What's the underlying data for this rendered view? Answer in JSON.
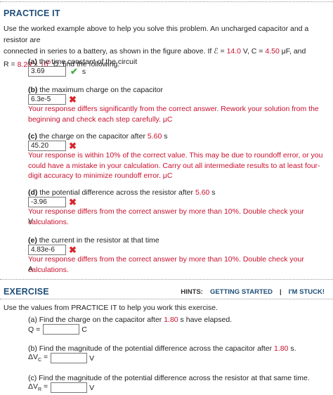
{
  "practice": {
    "title": "PRACTICE IT",
    "intro_line1": "Use the worked example above to help you solve this problem. An uncharged capacitor and a resistor are",
    "intro_line2_a": "connected in series to a battery, as shown in the figure above. If ℰ = ",
    "emf": "14.0",
    "intro_line2_b": " V, C = ",
    "cap": "4.50",
    "intro_line2_c": " μF, and",
    "intro_line3_a": "R = ",
    "res": "8.20 × 10",
    "res_exp": "5",
    "intro_line3_b": " Ω, find the following.",
    "parts": [
      {
        "label": "(a)",
        "question": " the time constant of the circuit",
        "answer": "3.69",
        "unit": "s",
        "status": "correct",
        "message": "",
        "unit_after": ""
      },
      {
        "label": "(b)",
        "question": " the maximum charge on the capacitor",
        "answer": "6.3e-5",
        "unit": "",
        "status": "incorrect",
        "message": "Your response differs significantly from the correct answer. Rework your solution from the beginning and check each step carefully. μC",
        "unit_after": ""
      },
      {
        "label": "(c)",
        "question_a": " the charge on the capacitor after ",
        "time": "5.60",
        "question_b": " s",
        "answer": "45.20",
        "unit": "",
        "status": "incorrect",
        "message": "Your response is within 10% of the correct value. This may be due to roundoff error, or you could have a mistake in your calculation. Carry out all intermediate results to at least four-digit accuracy to minimize roundoff error. μC",
        "unit_after": ""
      },
      {
        "label": "(d)",
        "question_a": " the potential difference across the resistor after ",
        "time": "5.60",
        "question_b": " s",
        "answer": "-3.96",
        "unit": "",
        "status": "incorrect",
        "message": "Your response differs from the correct answer by more than 10%. Double check your calculations.",
        "unit_after": "V"
      },
      {
        "label": "(e)",
        "question": " the current in the resistor at that time",
        "answer": "4.83e-6",
        "unit": "",
        "status": "incorrect",
        "message": "Your response differs from the correct answer by more than 10%. Double check your calculations.",
        "unit_after": "A"
      }
    ]
  },
  "exercise": {
    "title": "EXERCISE",
    "hints_label": "HINTS:",
    "getting_started": "GETTING STARTED",
    "separator": "|",
    "im_stuck": "I'M STUCK!",
    "intro": "Use the values from PRACTICE IT to help you work this exercise.",
    "parts": [
      {
        "label": "(a)",
        "question_a": " Find the charge on the capacitor after ",
        "time": "1.80",
        "question_b": " s have elapsed.",
        "var": "Q =",
        "value": "",
        "unit": "C"
      },
      {
        "label": "(b)",
        "question_a": " Find the magnitude of the potential difference across the capacitor after ",
        "time": "1.80",
        "question_b": " s.",
        "var": "ΔV",
        "var_sub": "C",
        "var_eq": " =",
        "value": "",
        "unit": "V"
      },
      {
        "label": "(c)",
        "question_a": " Find the magnitude of the potential difference across the resistor at that same time.",
        "var": "ΔV",
        "var_sub": "R",
        "var_eq": " =",
        "value": "",
        "unit": "V"
      }
    ]
  },
  "colors": {
    "title": "#1f4e79",
    "error": "#c8102e",
    "correct": "#4caf50"
  },
  "icons": {
    "correct": "checkmark-icon",
    "incorrect": "x-mark-icon"
  }
}
